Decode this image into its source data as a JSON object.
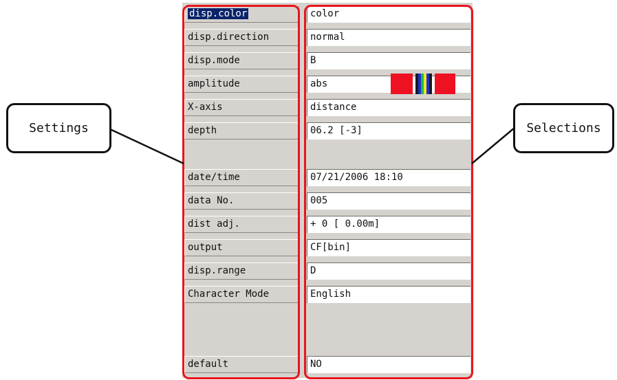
{
  "settings": [
    {
      "label": "disp.color",
      "value": "color",
      "selected": true
    },
    {
      "label": "disp.direction",
      "value": "normal"
    },
    {
      "label": "disp.mode",
      "value": "B"
    },
    {
      "label": "amplitude",
      "value": "abs"
    },
    {
      "label": "X-axis",
      "value": "distance"
    },
    {
      "label": "depth",
      "value": "06.2 [-3]"
    },
    {
      "label": "",
      "value": ""
    },
    {
      "label": "date/time",
      "value": "07/21/2006 18:10"
    },
    {
      "label": "data No.",
      "value": "005"
    },
    {
      "label": "dist adj.",
      "value": "+ 0 [ 0.00m]"
    },
    {
      "label": "output",
      "value": "CF[bin]"
    },
    {
      "label": "disp.range",
      "value": "D"
    },
    {
      "label": "Character Mode",
      "value": "English"
    },
    {
      "label": "",
      "value": ""
    },
    {
      "label": "",
      "value": ""
    },
    {
      "label": "default",
      "value": "NO"
    }
  ],
  "amplitude_swatch_colors": [
    "#ee1122",
    "#ee1122",
    "#1a1a1a",
    "#1f2fcf",
    "#23b84a",
    "#e8e820",
    "#1f2fcf",
    "#1a1a1a",
    "#ee1122",
    "#ee1122"
  ],
  "callouts": {
    "left": "Settings",
    "right": "Selections"
  },
  "colors": {
    "frame": "#e8141c",
    "selection_bg": "#0a246a"
  }
}
